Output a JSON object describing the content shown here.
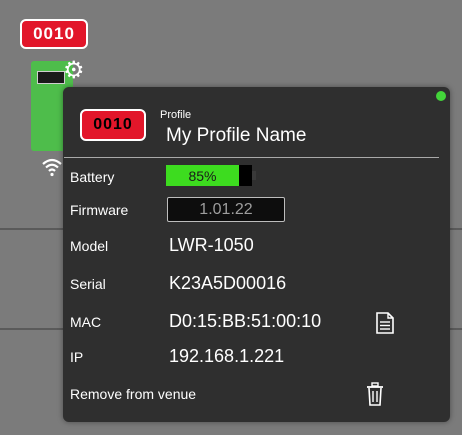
{
  "canvas": {
    "badge_label": "0010"
  },
  "card": {
    "badge_label": "0010",
    "profile_caption": "Profile",
    "profile_name": "My Profile Name",
    "status_color": "#43d43a",
    "battery": {
      "label": "Battery",
      "value_text": "85%",
      "level_fraction": 0.85,
      "fill_color": "#3ddc1f"
    },
    "firmware": {
      "label": "Firmware",
      "value": "1.01.22"
    },
    "model": {
      "label": "Model",
      "value": "LWR-1050"
    },
    "serial": {
      "label": "Serial",
      "value": "K23A5D00016"
    },
    "mac": {
      "label": "MAC",
      "value": "D0:15:BB:51:00:10",
      "icon": "copy-icon"
    },
    "ip": {
      "label": "IP",
      "value": "192.168.1.221"
    },
    "remove": {
      "label": "Remove from venue",
      "icon": "trash-icon"
    }
  }
}
